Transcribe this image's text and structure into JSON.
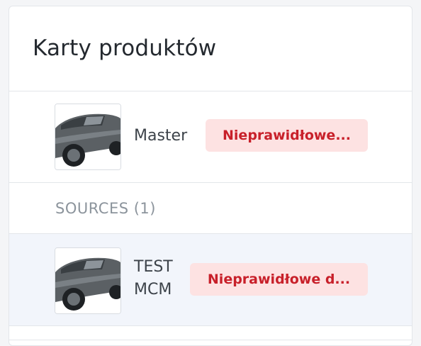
{
  "card": {
    "title": "Karty produktów"
  },
  "master": {
    "name": "Master",
    "thumbnail": "car-thumbnail",
    "status": "Nieprawidłowe..."
  },
  "sources": {
    "header": "SOURCES (1)",
    "items": [
      {
        "name": "TEST MCM",
        "thumbnail": "car-thumbnail",
        "status": "Nieprawidłowe d..."
      }
    ]
  },
  "colors": {
    "badge_background": "#fde2e2",
    "badge_text": "#c8202a",
    "selected_row": "#f2f5fb"
  }
}
